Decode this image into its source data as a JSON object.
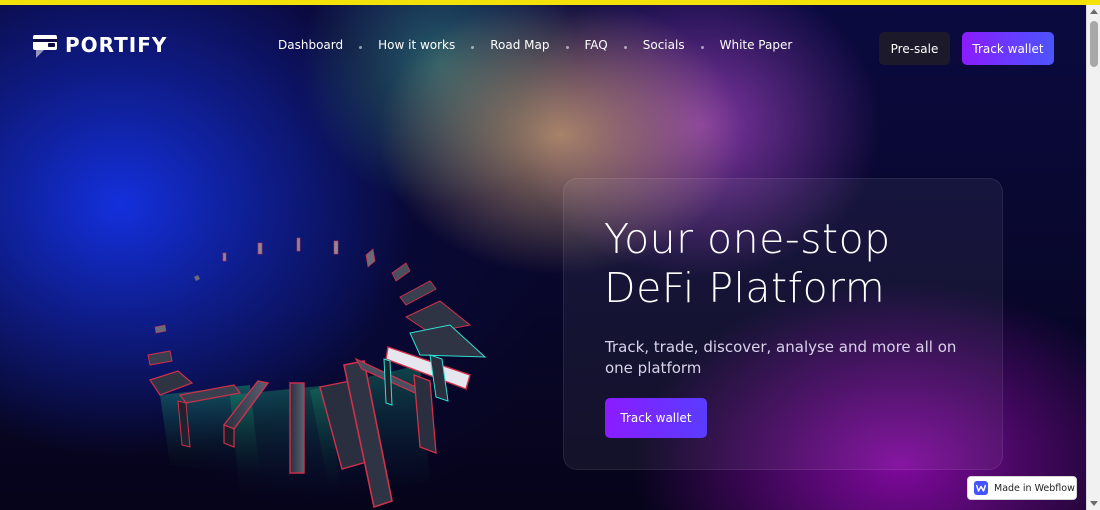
{
  "brand": {
    "name": "PORTIFY"
  },
  "nav": {
    "links": [
      {
        "label": "Dashboard"
      },
      {
        "label": "How it works"
      },
      {
        "label": "Road Map"
      },
      {
        "label": "FAQ"
      },
      {
        "label": "Socials"
      },
      {
        "label": "White Paper"
      }
    ],
    "presale_label": "Pre-sale",
    "track_wallet_label": "Track wallet"
  },
  "hero": {
    "title_line1": "Your one-stop",
    "title_line2": "DeFi Platform",
    "subtitle": "Track, trade, discover, analyse and more all on one platform",
    "cta_label": "Track wallet"
  },
  "badge": {
    "label": "Made in Webflow"
  },
  "colors": {
    "accent_start": "#8a1cff",
    "accent_end": "#4b55ff",
    "background": "#06041a",
    "top_strip": "#f3e20a"
  },
  "icons": {
    "logo": "wallet-icon",
    "badge": "webflow-logo-icon"
  }
}
